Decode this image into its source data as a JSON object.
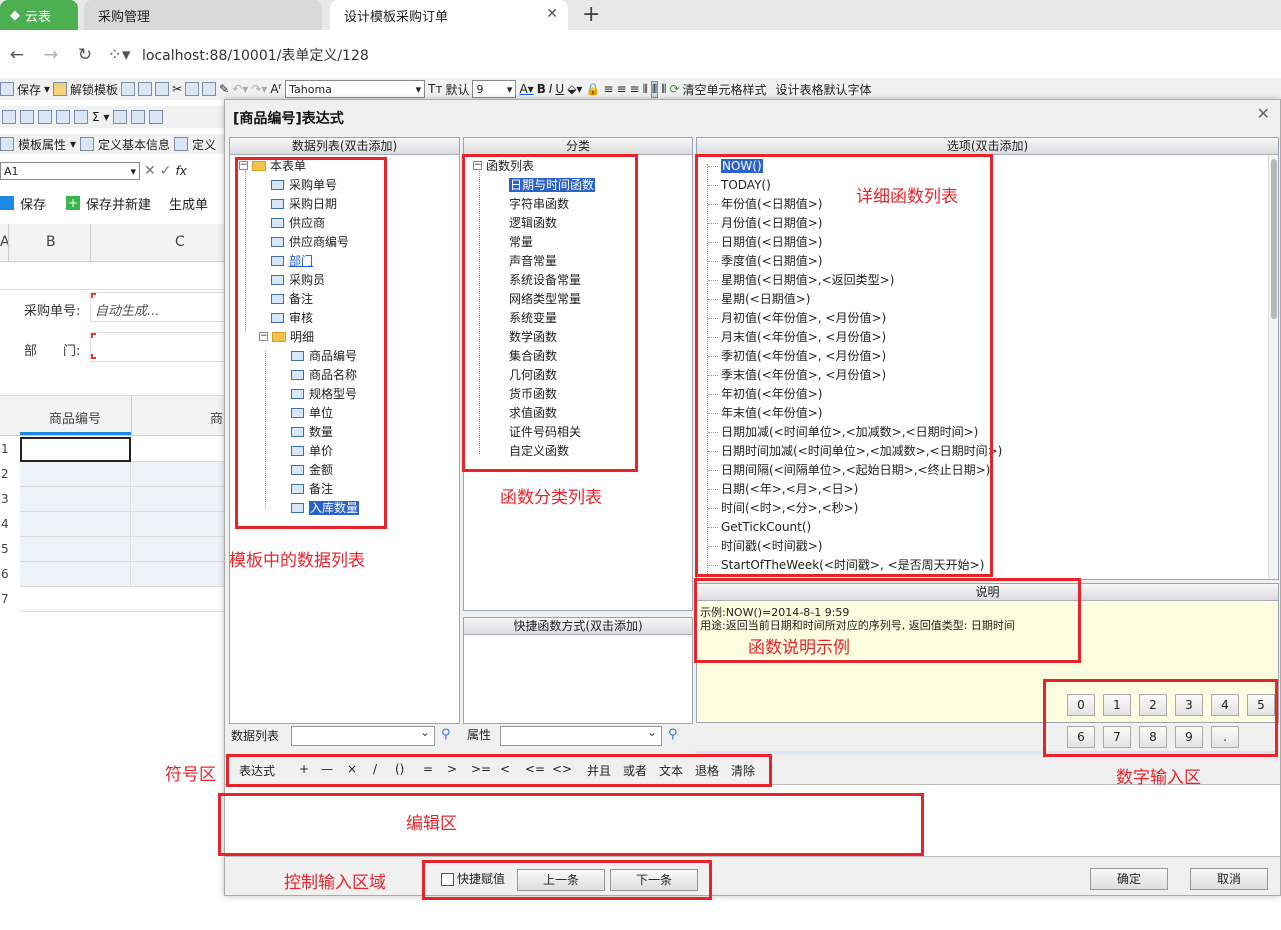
{
  "browser": {
    "tabs": [
      "云表",
      "采购管理",
      "设计模板采购订单"
    ],
    "address": "localhost:88/10001/表单定义/128"
  },
  "toolbar1": {
    "save": "保存",
    "unlock": "解锁模板",
    "font": "Tahoma",
    "default_font": "默认",
    "font_size": "9",
    "clear_style": "清空单元格样式",
    "set_default_font": "设计表格默认字体"
  },
  "toolbar3": {
    "template_props": "模板属性",
    "define_basic": "定义基本信息",
    "define_short": "定义"
  },
  "formula_bar": {
    "cell_ref": "A1",
    "fx": "fx"
  },
  "save_bar": {
    "save": "保存",
    "save_new": "保存并新建",
    "generate": "生成单"
  },
  "sheet": {
    "columns": [
      "A",
      "B",
      "C"
    ],
    "fields": [
      {
        "label": "采购单号:",
        "value": "自动生成..."
      },
      {
        "label": "部　　门:",
        "value": ""
      }
    ],
    "detail_header": [
      "商品编号",
      "商"
    ],
    "rows": [
      "1",
      "2",
      "3",
      "4",
      "5",
      "6",
      "7"
    ]
  },
  "dialog": {
    "title": "[商品编号]表达式",
    "data_list_header": "数据列表(双击添加)",
    "category_header": "分类",
    "options_header": "选项(双击添加)",
    "desc_header": "说明",
    "quick_header": "快捷函数方式(双击添加)",
    "tree": {
      "root": "本表单",
      "fields": [
        "采购单号",
        "采购日期",
        "供应商",
        "供应商编号",
        "部门",
        "采购员",
        "备注",
        "审核"
      ],
      "detail": "明细",
      "detail_fields": [
        "商品编号",
        "商品名称",
        "规格型号",
        "单位",
        "数量",
        "单价",
        "金额",
        "备注",
        "入库数量"
      ]
    },
    "categories": {
      "root": "函数列表",
      "items": [
        "日期与时间函数",
        "字符串函数",
        "逻辑函数",
        "常量",
        "声音常量",
        "系统设备常量",
        "网络类型常量",
        "系统变量",
        "数学函数",
        "集合函数",
        "几何函数",
        "货币函数",
        "求值函数",
        "证件号码相关",
        "自定义函数"
      ]
    },
    "functions": [
      "NOW()",
      "TODAY()",
      "年份值(<日期值>)",
      "月份值(<日期值>)",
      "日期值(<日期值>)",
      "季度值(<日期值>)",
      "星期值(<日期值>,<返回类型>)",
      "星期(<日期值>)",
      "月初值(<年份值>, <月份值>)",
      "月末值(<年份值>, <月份值>)",
      "季初值(<年份值>, <月份值>)",
      "季末值(<年份值>, <月份值>)",
      "年初值(<年份值>)",
      "年末值(<年份值>)",
      "日期加减(<时间单位>,<加减数>,<日期时间>)",
      "日期时间加减(<时间单位>,<加减数>,<日期时间>)",
      "日期间隔(<间隔单位>,<起始日期>,<终止日期>)",
      "日期(<年>,<月>,<日>)",
      "时间(<时>,<分>,<秒>)",
      "GetTickCount()",
      "时间戳(<时间戳>)",
      "StartOfTheWeek(<时间戳>, <是否周天开始>)"
    ],
    "description": {
      "example": "示例:NOW()=2014-8-1 9:59",
      "usage": "用途:返回当前日期和时间所对应的序列号, 返回值类型: 日期时间"
    },
    "numpad": [
      "0",
      "1",
      "2",
      "3",
      "4",
      "5",
      "6",
      "7",
      "8",
      "9",
      "."
    ],
    "data_list_label": "数据列表",
    "attr_label": "属性",
    "symbols": [
      "表达式",
      "+",
      "—",
      "×",
      "/",
      "()",
      "=",
      ">",
      ">=",
      "<",
      "<=",
      "<>",
      "并且",
      "或者",
      "文本",
      "退格",
      "清除"
    ],
    "quick_assign": "快捷赋值",
    "prev": "上一条",
    "next": "下一条",
    "ok": "确定",
    "cancel": "取消"
  },
  "annotations": {
    "data_list": "模板中的数据列表",
    "category": "函数分类列表",
    "detail_funcs": "详细函数列表",
    "desc_example": "函数说明示例",
    "symbols": "符号区",
    "numpad": "数字输入区",
    "edit": "编辑区",
    "control": "控制输入区域"
  },
  "colors": {
    "accent_red": "#e8232a",
    "selection": "#2a62c9",
    "desc_bg": "#fdfde0",
    "brand_green": "#4caf50"
  }
}
